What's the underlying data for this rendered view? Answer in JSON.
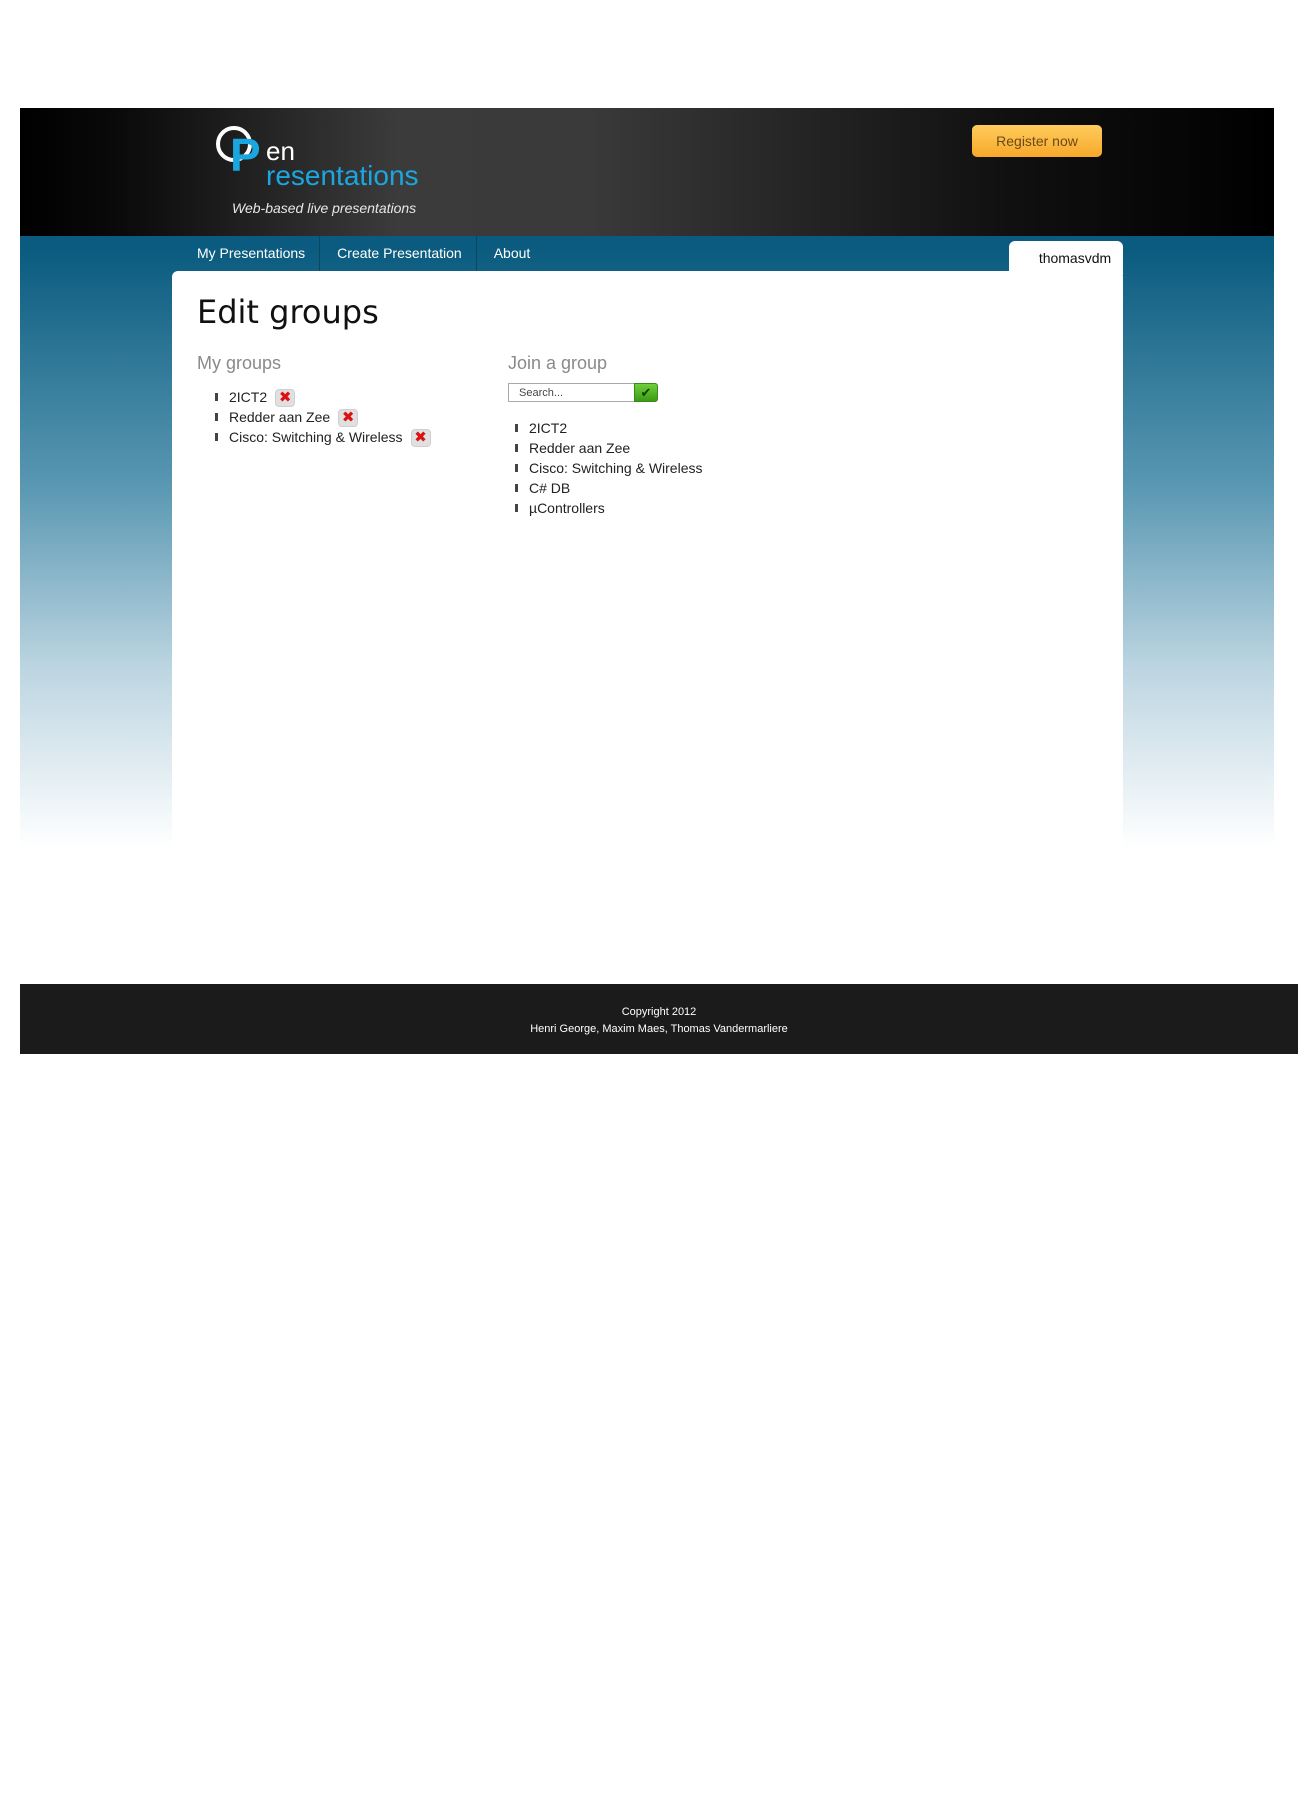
{
  "header": {
    "logo": {
      "letter_o": "O",
      "letter_p": "P",
      "word_en": "en",
      "word_resentations": "resentations",
      "tagline": "Web-based live presentations"
    },
    "register_label": "Register now"
  },
  "nav": {
    "items": [
      {
        "label": "My Presentations"
      },
      {
        "label": "Create Presentation"
      },
      {
        "label": "About"
      }
    ],
    "user": "thomasvdm"
  },
  "main": {
    "title": "Edit groups",
    "my_groups": {
      "title": "My groups",
      "items": [
        {
          "label": "2ICT2",
          "remove_icon": "remove-icon"
        },
        {
          "label": "Redder aan Zee",
          "remove_icon": "remove-icon"
        },
        {
          "label": "Cisco: Switching & Wireless",
          "remove_icon": "remove-icon"
        }
      ]
    },
    "join_group": {
      "title": "Join a group",
      "search": {
        "placeholder": "Search...",
        "value": "",
        "button_icon": "check-icon"
      },
      "items": [
        {
          "label": "2ICT2"
        },
        {
          "label": "Redder aan Zee"
        },
        {
          "label": "Cisco: Switching & Wireless"
        },
        {
          "label": "C# DB"
        },
        {
          "label": "µControllers"
        }
      ]
    }
  },
  "footer": {
    "copyright": "Copyright 2012",
    "authors": "Henri George, Maxim Maes, Thomas Vandermarliere"
  },
  "colors": {
    "brand_blue": "#1aa7e0",
    "nav_blue": "#0a5b7f",
    "register_orange": "#f7a82a",
    "search_green": "#4caf1e",
    "remove_red": "#dd1111"
  }
}
